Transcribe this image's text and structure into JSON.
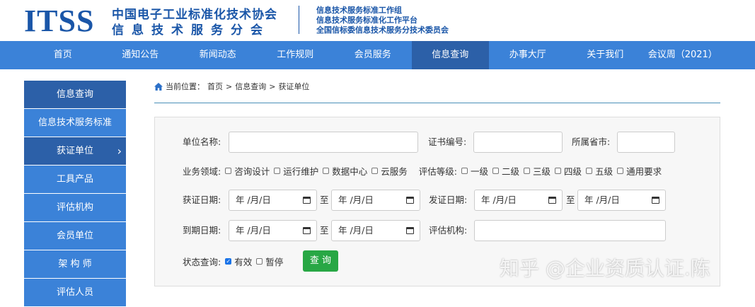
{
  "header": {
    "logo": "ITSS",
    "org_line1": "中国电子工业标准化技术协会",
    "org_line2": "信息技术服务分会",
    "sub_lines": [
      "信息技术服务标准工作组",
      "信息技术服务标准化工作平台",
      "全国信标委信息技术服务分技术委员会"
    ]
  },
  "nav": {
    "items": [
      "首页",
      "通知公告",
      "新闻动态",
      "工作规则",
      "会员服务",
      "信息查询",
      "办事大厅",
      "关于我们",
      "会议周（2021）"
    ],
    "active": "信息查询"
  },
  "sidebar": {
    "items": [
      "信息查询",
      "信息技术服务标准",
      "获证单位",
      "工具产品",
      "评估机构",
      "会员单位",
      "架 构 师",
      "评估人员"
    ]
  },
  "breadcrumb": {
    "prefix": "当前位置：",
    "items": [
      "首页",
      "信息查询",
      "获证单位"
    ],
    "sep": ">"
  },
  "form": {
    "unit_name_label": "单位名称:",
    "cert_no_label": "证书编号:",
    "province_label": "所属省市:",
    "domain_label": "业务领域:",
    "domains": [
      "咨询设计",
      "运行维护",
      "数据中心",
      "云服务"
    ],
    "level_label": "评估等级:",
    "levels": [
      "一级",
      "二级",
      "三级",
      "四级",
      "五级",
      "通用要求"
    ],
    "obtain_date_label": "获证日期:",
    "issue_date_label": "发证日期:",
    "expire_date_label": "到期日期:",
    "agency_label": "评估机构:",
    "to": "至",
    "date_placeholder": "年 /月/日",
    "status_label": "状态查询:",
    "status_options": [
      {
        "label": "有效",
        "checked": true
      },
      {
        "label": "暂停",
        "checked": false
      }
    ],
    "submit": "查 询"
  },
  "watermark": "知乎 @企业资质认证.陈"
}
